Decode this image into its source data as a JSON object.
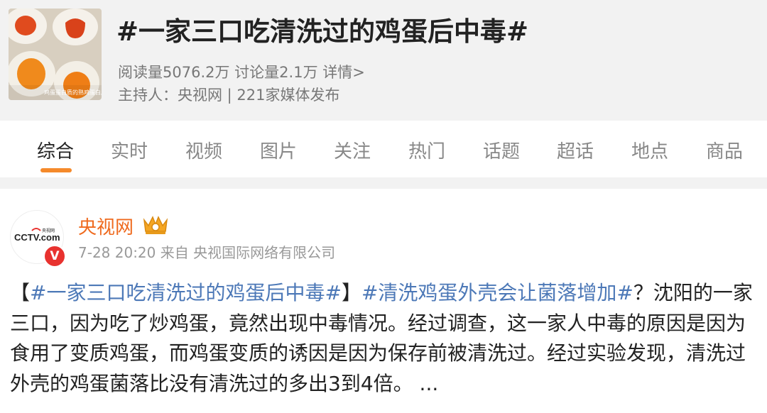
{
  "topic": {
    "title": "#一家三口吃清洗过的鸡蛋后中毒#",
    "read_label": "阅读量",
    "read_count": "5076.2万",
    "discuss_label": "讨论量",
    "discuss_count": "2.1万",
    "details_link": "详情>",
    "host_text": "主持人：央视网 | 221家媒体发布",
    "thumbnail_caption": "鸡蛋蛋白质的熟鸡蛋白质"
  },
  "tabs": [
    {
      "label": "综合",
      "active": true
    },
    {
      "label": "实时",
      "active": false
    },
    {
      "label": "视频",
      "active": false
    },
    {
      "label": "图片",
      "active": false
    },
    {
      "label": "关注",
      "active": false
    },
    {
      "label": "热门",
      "active": false
    },
    {
      "label": "话题",
      "active": false
    },
    {
      "label": "超话",
      "active": false
    },
    {
      "label": "地点",
      "active": false
    },
    {
      "label": "商品",
      "active": false
    }
  ],
  "post": {
    "author": "央视网",
    "avatar_logo": "CCTV.com",
    "avatar_logo_sub": "央视网",
    "verified_badge": "V",
    "timestamp": "7-28 20:20",
    "source_prefix": "来自",
    "source": "央视国际网络有限公司",
    "bracket_open": "【",
    "hashtag1": "#一家三口吃清洗过的鸡蛋后中毒#",
    "bracket_close": "】",
    "hashtag2": "#清洗鸡蛋外壳会让菌落增加#",
    "text_after_hashtags": "？沈阳的一家三口，因为吃了炒鸡蛋，竟然出现中毒情况。经过调查，这一家人中毒的原因是因为食用了变质鸡蛋，而鸡蛋变质的诱因是因为保存前被清洗过。经过实验发现，清洗过外壳的鸡蛋菌落比没有清洗过的多出3到4倍。",
    "ellipsis": " ..."
  },
  "colors": {
    "accent": "#f58a2b",
    "author": "#ef6a1e",
    "link": "#4c78b7",
    "verified": "#e8322f",
    "header_bg": "#f2f2f2"
  },
  "icons": {
    "crown": "crown-icon",
    "verified": "verified-icon"
  }
}
